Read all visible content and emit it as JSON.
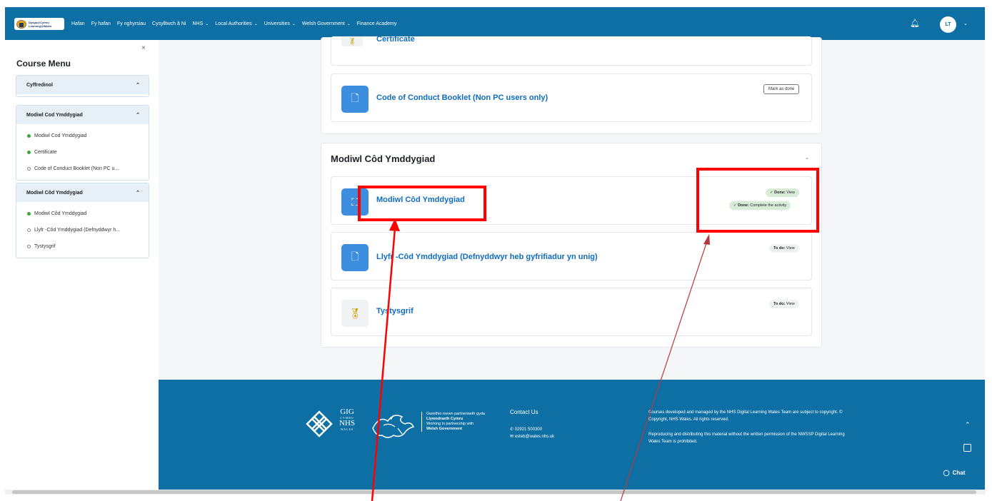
{
  "logo": {
    "line1": "Dysgu@Cymru",
    "line2": "Learning@Wales"
  },
  "nav": {
    "items": [
      {
        "label": "Hafan"
      },
      {
        "label": "Fy hafan"
      },
      {
        "label": "Fy nghyrsiau"
      },
      {
        "label": "Cysylltwch â Ni"
      },
      {
        "label": "NHS",
        "dropdown": true
      },
      {
        "label": "Local Authorities",
        "dropdown": true
      },
      {
        "label": "Universities",
        "dropdown": true
      },
      {
        "label": "Welsh Government",
        "dropdown": true
      },
      {
        "label": "Finance Academy"
      }
    ],
    "user_initials": "LT"
  },
  "sidebar": {
    "close": "×",
    "title": "Course Menu",
    "sections": [
      {
        "title": "Cyffredinol",
        "items": []
      },
      {
        "title": "Modiwl Cod Ymddygiad",
        "items": [
          {
            "label": "Modiwl Cod Ymddygiad",
            "status": "done"
          },
          {
            "label": "Certificate",
            "status": "done"
          },
          {
            "label": "Code of Conduct Booklet (Non PC u...",
            "status": "todo"
          }
        ]
      },
      {
        "title": "Modiwl Côd Ymddygiad",
        "items": [
          {
            "label": "Modiwl Côd Ymddygiad",
            "status": "done"
          },
          {
            "label": "Llyfr -Côd Ymddygiad (Defnyddwyr h...",
            "status": "todo"
          },
          {
            "label": "Tystysgrif",
            "status": "todo"
          }
        ]
      }
    ]
  },
  "main": {
    "top_card": {
      "certificate": "Certificate",
      "booklet": "Code of Conduct Booklet (Non PC users only)",
      "mark_done": "Mark as done"
    },
    "section": {
      "title": "Modiwl Côd Ymddygiad",
      "activities": [
        {
          "name": "Modiwl Côd Ymddygiad",
          "badges": [
            {
              "label": "Done:",
              "value": "View"
            },
            {
              "label": "Done:",
              "value": "Complete the activity"
            }
          ]
        },
        {
          "name": "Llyfr -Côd Ymddygiad (Defnyddwyr heb gyfrifiadur yn unig)",
          "badges": [
            {
              "label": "To do:",
              "value": "View"
            }
          ]
        },
        {
          "name": "Tystysgrif",
          "badges": [
            {
              "label": "To do:",
              "value": "View"
            }
          ]
        }
      ]
    }
  },
  "footer": {
    "gig": "GIG",
    "cymru": "CYMRU",
    "nhs": "NHS",
    "wales": "WALES",
    "partner1": "Gweithio mewn partneriaeth gyda",
    "partner2": "Llywodraeth Cymru",
    "partner3": "Working in partnership with",
    "partner4": "Welsh Government",
    "contact_title": "Contact Us",
    "phone": "02921 500300",
    "email": "esteb@wales.nhs.uk",
    "copy1": "Courses developed and managed by the NHS Digital Learning Wales Team are subject to copyright. © Copyright, NHS Wales. All rights reserved.",
    "copy2": "Reproducing and distributing this material without the written permission of the NWSSP Digital Learning Wales Team is prohibited."
  },
  "chat": {
    "label": "Chat"
  },
  "colors": {
    "brand": "#0d6fa3",
    "link": "#0f6cbf",
    "done": "#3fa53f",
    "annotation": "#ff0000"
  }
}
